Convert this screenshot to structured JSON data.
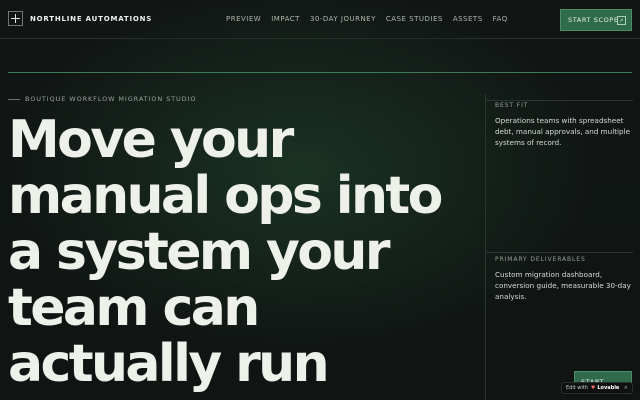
{
  "brand": {
    "name": "NORTHLINE AUTOMATIONS",
    "icon": "plus-grid-icon"
  },
  "nav": {
    "items": [
      "PREVIEW",
      "IMPACT",
      "30-DAY JOURNEY",
      "CASE STUDIES",
      "ASSETS",
      "FAQ"
    ]
  },
  "header": {
    "cta_label": "START SCOPE",
    "cta_icon": "arrow-up-right-icon"
  },
  "hero": {
    "eyebrow": "BOUTIQUE WORKFLOW MIGRATION STUDIO",
    "headline": "Move your manual ops into a system your team can actually run"
  },
  "side": {
    "best_fit_label": "BEST FIT",
    "best_fit_text": "Operations teams with spreadsheet debt, manual approvals, and multiple systems of record.",
    "deliverables_label": "PRIMARY DELIVERABLES",
    "deliverables_text": "Custom migration dashboard, conversion guide, measurable 30-day analysis.",
    "cta_label": "START SCOPE"
  },
  "badge": {
    "prefix": "Edit with",
    "brand": "Lovable",
    "close": "×"
  },
  "colors": {
    "accent": "#2f6a4a",
    "accent_line": "#3f7a58",
    "background": "#111614"
  }
}
